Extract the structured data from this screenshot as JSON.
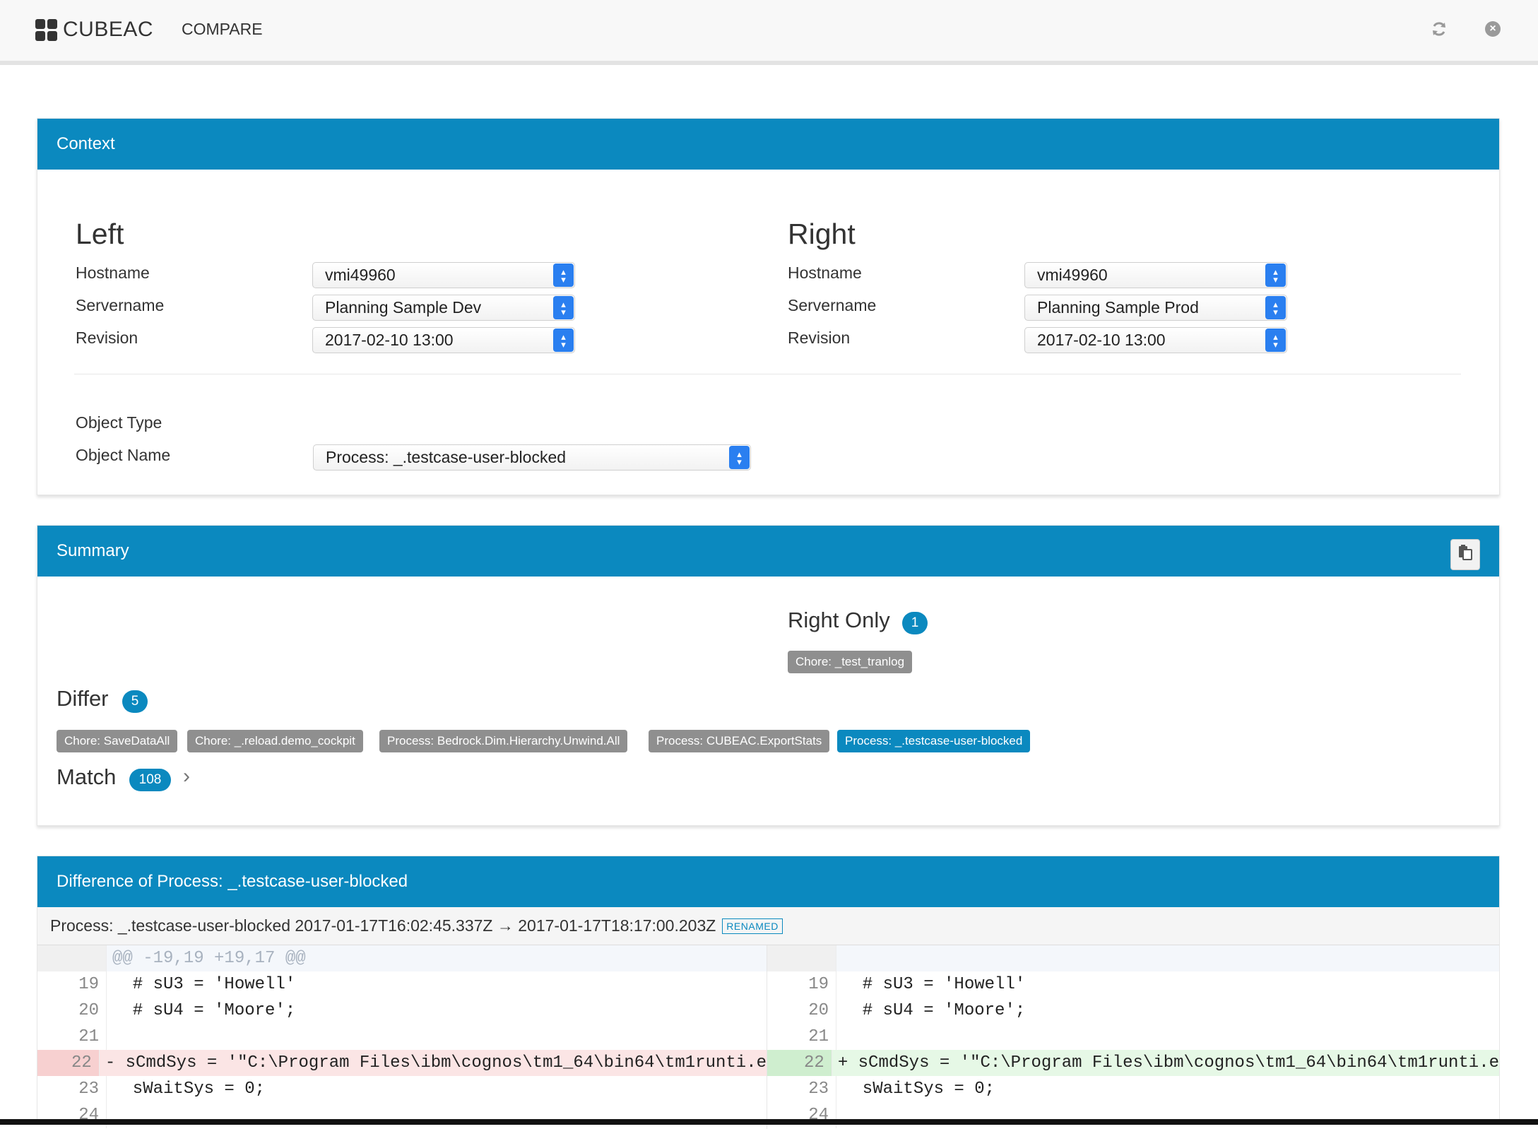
{
  "app": {
    "brand": "CUBEAC",
    "nav_compare": "COMPARE"
  },
  "icons": {
    "brand": "grid-icon",
    "refresh": "refresh-icon",
    "close": "close-circle-icon",
    "copy": "clipboard-icon",
    "chevron": "chevron-right-icon"
  },
  "colors": {
    "primary": "#0b89bf",
    "tag_gray": "#8f8f8f",
    "select_arrow": "#2a7ff0",
    "diff_del": "#fbe5e5",
    "diff_add": "#e6f8e6"
  },
  "context": {
    "title": "Context",
    "left": {
      "heading": "Left",
      "hostname_label": "Hostname",
      "hostname": "vmi49960",
      "servername_label": "Servername",
      "servername": "Planning Sample Dev",
      "revision_label": "Revision",
      "revision": "2017-02-10 13:00"
    },
    "right": {
      "heading": "Right",
      "hostname_label": "Hostname",
      "hostname": "vmi49960",
      "servername_label": "Servername",
      "servername": "Planning Sample Prod",
      "revision_label": "Revision",
      "revision": "2017-02-10 13:00"
    },
    "object_type_label": "Object Type",
    "object_name_label": "Object Name",
    "object_name": "Process: _.testcase-user-blocked"
  },
  "summary": {
    "title": "Summary",
    "right_only": {
      "label": "Right Only",
      "count": "1",
      "items": [
        "Chore: _test_tranlog"
      ]
    },
    "differ": {
      "label": "Differ",
      "count": "5",
      "items": [
        "Chore: SaveDataAll",
        "Chore: _.reload.demo_cockpit",
        "Process: Bedrock.Dim.Hierarchy.Unwind.All",
        "Process: CUBEAC.ExportStats",
        "Process: _.testcase-user-blocked"
      ],
      "active_index": 4
    },
    "match": {
      "label": "Match",
      "count": "108"
    }
  },
  "difference": {
    "title": "Difference of Process: _.testcase-user-blocked",
    "file_header": "Process: _.testcase-user-blocked 2017-01-17T16:02:45.337Z → 2017-01-17T18:17:00.203Z",
    "renamed_badge": "RENAMED",
    "hunk": "@@ -19,19 +19,17 @@",
    "left_lines": [
      {
        "n": "19",
        "text": "  # sU3 = 'Howell'"
      },
      {
        "n": "20",
        "text": "  # sU4 = 'Moore';"
      },
      {
        "n": "21",
        "text": ""
      },
      {
        "n": "22",
        "text": "- sCmdSys = '\"C:\\Program Files\\ibm\\cognos\\tm1_64\\bin64\\tm1runti.e"
      },
      {
        "n": "23",
        "text": "  sWaitSys = 0;"
      },
      {
        "n": "24",
        "text": ""
      }
    ],
    "right_lines": [
      {
        "n": "19",
        "text": "  # sU3 = 'Howell'"
      },
      {
        "n": "20",
        "text": "  # sU4 = 'Moore';"
      },
      {
        "n": "21",
        "text": ""
      },
      {
        "n": "22",
        "text": "+ sCmdSys = '\"C:\\Program Files\\ibm\\cognos\\tm1_64\\bin64\\tm1runti.e"
      },
      {
        "n": "23",
        "text": "  sWaitSys = 0;"
      },
      {
        "n": "24",
        "text": ""
      }
    ]
  }
}
